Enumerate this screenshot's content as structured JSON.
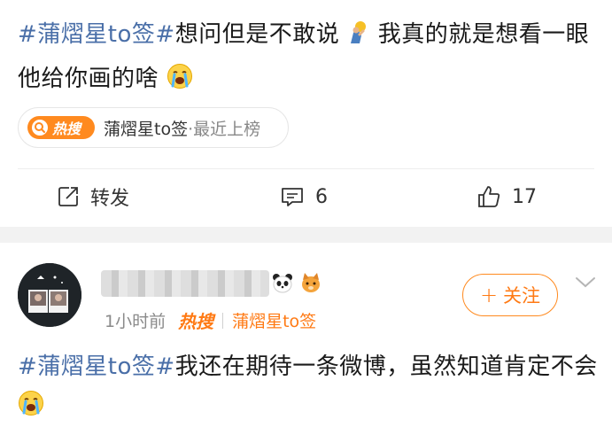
{
  "post1": {
    "hashtag": "#蒲熠星to签#",
    "text_part1": "想问但是不敢说",
    "text_part2": "我真的就是想看一眼他给你画的啥",
    "hot_chip": {
      "badge": "热搜",
      "topic": "蒲熠星to签",
      "rank": "·最近上榜"
    },
    "actions": {
      "repost_label": "转发",
      "comment_count": "6",
      "like_count": "17"
    }
  },
  "post2": {
    "time": "1小时前",
    "hot_label": "热搜",
    "topic": "蒲熠星to签",
    "follow_label": "关注",
    "hashtag": "#蒲熠星to签#",
    "text": "我还在期待一条微博，虽然知道肯定不会"
  },
  "colors": {
    "hashtag": "#4a6fa8",
    "accent_orange": "#ff7a14",
    "divider": "#f2f2f2"
  },
  "icons": [
    "thinking-emoji-icon",
    "crying-emoji-icon",
    "search-icon",
    "repost-icon",
    "comment-icon",
    "like-icon",
    "plus-icon",
    "chevron-down-icon",
    "panda-emoji-icon",
    "dog-emoji-icon"
  ]
}
